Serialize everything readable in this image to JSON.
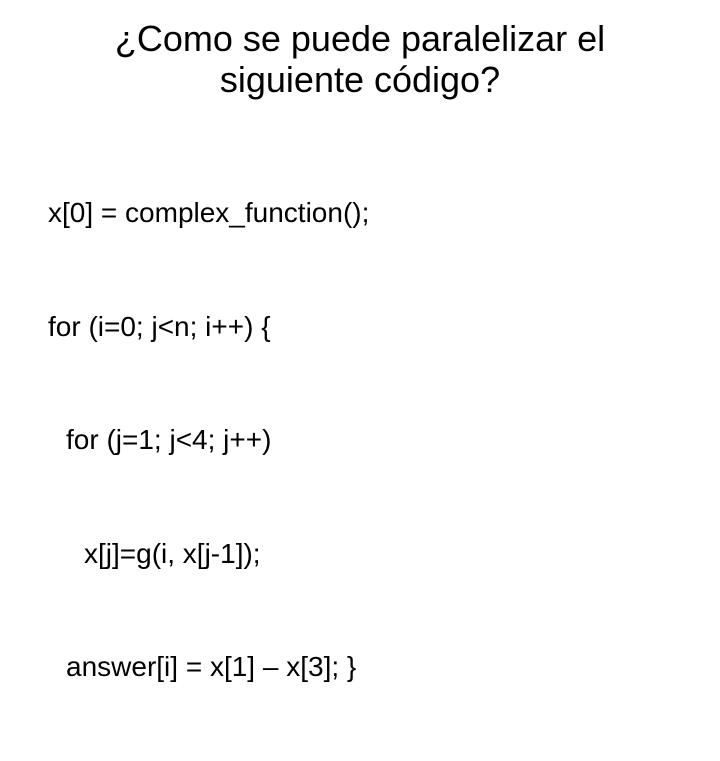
{
  "title_line1": "¿Como se puede paralelizar el",
  "title_line2": "siguiente código?",
  "code": {
    "l1": "x[0] = complex_function();",
    "l2": "for (i=0; j<n; i++) {",
    "l3": "for (j=1; j<4; j++)",
    "l4": "x[j]=g(i, x[j-1]);",
    "l5": "answer[i] = x[1] – x[3]; }"
  }
}
